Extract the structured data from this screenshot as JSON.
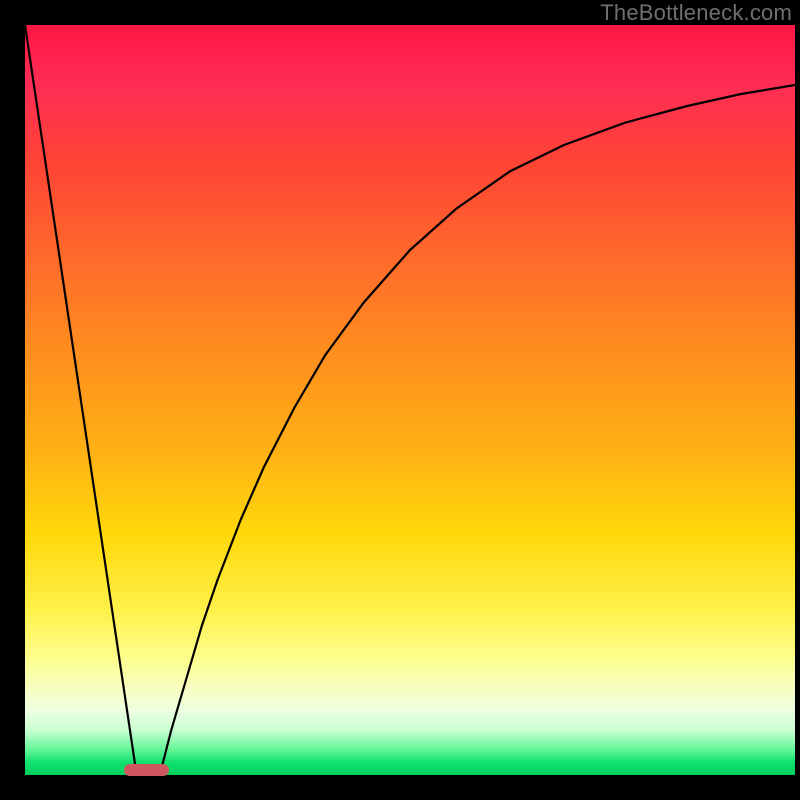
{
  "watermark": "TheBottleneck.com",
  "chart_data": {
    "type": "line",
    "title": "",
    "xlabel": "",
    "ylabel": "",
    "xlim": [
      0,
      100
    ],
    "ylim": [
      0,
      100
    ],
    "grid": false,
    "legend": false,
    "series": [
      {
        "name": "left-diagonal",
        "x": [
          0,
          14.5
        ],
        "y": [
          100,
          0
        ]
      },
      {
        "name": "right-curve",
        "x": [
          17.5,
          19,
          21,
          23,
          25,
          28,
          31,
          35,
          39,
          44,
          50,
          56,
          63,
          70,
          78,
          86,
          93,
          100
        ],
        "y": [
          0,
          6,
          13,
          20,
          26,
          34,
          41,
          49,
          56,
          63,
          70,
          75.5,
          80.5,
          84,
          87,
          89.2,
          90.8,
          92
        ]
      }
    ],
    "marker": {
      "x_center_pct": 15.8,
      "width_pct": 5.8
    },
    "background_gradient": {
      "top": "#ff1744",
      "mid": "#ffd90a",
      "bottom": "#00d05a"
    }
  }
}
